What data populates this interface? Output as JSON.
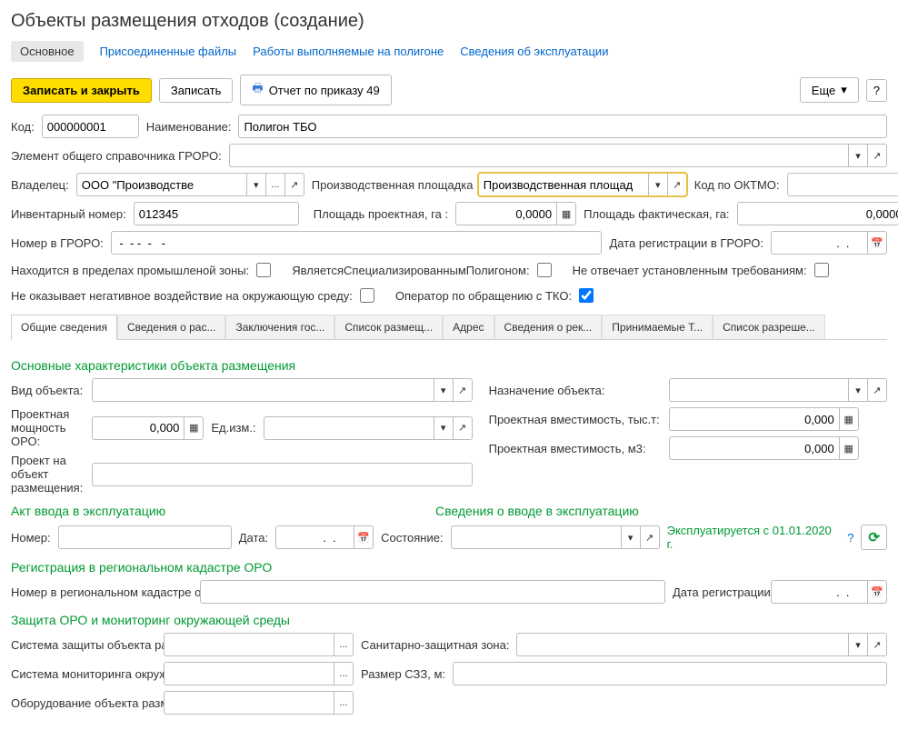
{
  "page_title": "Объекты размещения отходов (создание)",
  "nav": {
    "main": "Основное",
    "attached": "Присоединенные файлы",
    "works": "Работы выполняемые на полигоне",
    "operation": "Сведения об эксплуатации"
  },
  "toolbar": {
    "save_close": "Записать и закрыть",
    "save": "Записать",
    "report": "Отчет по приказу 49",
    "more": "Еще",
    "help": "?"
  },
  "main_form": {
    "code_label": "Код:",
    "code_value": "000000001",
    "name_label": "Наименование:",
    "name_value": "Полигон ТБО",
    "groro_el_label": "Элемент общего справочника ГРОРО:",
    "groro_el_value": "",
    "owner_label": "Владелец:",
    "owner_value": "ООО \"Производстве",
    "site_label": "Производственная площадка (основная):",
    "site_value": "Производственная площад",
    "oktmo_label": "Код по ОКТМО:",
    "oktmo_value": "",
    "inv_label": "Инвентарный номер:",
    "inv_value": "012345",
    "area_proj_label": "Площадь проектная, га :",
    "area_proj_value": "0,0000",
    "area_fact_label": "Площадь фактическая, га:",
    "area_fact_value": "0,0000",
    "groro_num_label": "Номер в ГРОРО:",
    "groro_num_value": " -  - -  -   - ",
    "groro_date_label": "Дата регистрации в ГРОРО:",
    "groro_date_value": "  .  .    ",
    "check_zone_label": "Находится в пределах промышленой зоны:",
    "check_spec_label": "ЯвляетсяСпециализированнымПолигоном:",
    "check_req_label": "Не отвечает установленным требованиям:",
    "check_neg_label": "Не оказывает негативное воздействие на окружающую среду:",
    "check_tko_label": "Оператор по обращению с ТКО:"
  },
  "tabs": {
    "t1": "Общие сведения",
    "t2": "Сведения о рас...",
    "t3": "Заключения гос...",
    "t4": "Список размещ...",
    "t5": "Адрес",
    "t6": "Сведения о рек...",
    "t7": "Принимаемые Т...",
    "t8": "Список разреше..."
  },
  "general": {
    "section1": "Основные характеристики объекта размещения",
    "obj_type_label": "Вид объекта:",
    "purpose_label": "Назначение объекта:",
    "capacity_label": "Проектная мощность ОРО:",
    "capacity_value": "0,000",
    "unit_label": "Ед.изм.:",
    "proj_label": "Проект на объект размещения:",
    "vol_t_label": "Проектная вместимость, тыс.т:",
    "vol_t_value": "0,000",
    "vol_m3_label": "Проектная вместимость, м3:",
    "vol_m3_value": "0,000",
    "section2": "Акт ввода в эксплуатацию",
    "section3": "Сведения о вводе в эксплуатацию",
    "act_num_label": "Номер:",
    "act_date_label": "Дата:",
    "act_date_value": "  .  .    ",
    "state_label": "Состояние:",
    "expl_text": "Эксплуатируется с 01.01.2020 г.",
    "section4": "Регистрация в региональном кадастре ОРО",
    "reg_num_label": "Номер в региональном кадастре отходов:",
    "reg_date_label": "Дата регистрации в РРОРО:",
    "reg_date_value": "  .  .    ",
    "section5": "Защита ОРО и мониторинг окружающей среды",
    "protect_label": "Система защиты объекта размещения:",
    "szz_label": "Санитарно-защитная зона:",
    "monitoring_label": "Система мониторинга окружающей среды:",
    "szz_size_label": "Размер СЗЗ, м:",
    "equip_label": "Оборудование объекта размещения:"
  },
  "icons": {
    "calc": "▦",
    "date": "📅",
    "dots": "...",
    "open": "↗",
    "refresh": "⟳",
    "printer": "🖶"
  }
}
